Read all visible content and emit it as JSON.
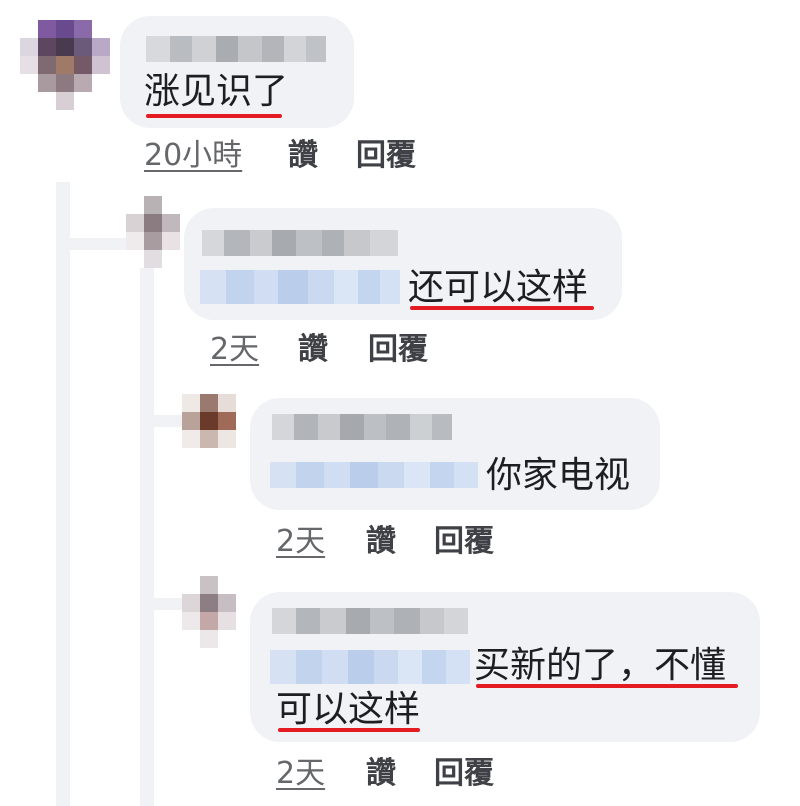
{
  "comments": [
    {
      "text_lines": [
        "涨见识了"
      ],
      "time": "20小時",
      "like": "讚",
      "reply": "回覆"
    },
    {
      "text_lines": [
        "还可以这样"
      ],
      "time": "2天",
      "like": "讚",
      "reply": "回覆"
    },
    {
      "text_lines": [
        "你家电视"
      ],
      "time": "2天",
      "like": "讚",
      "reply": "回覆"
    },
    {
      "text_lines": [
        "买新的了，不懂",
        "可以这样"
      ],
      "time": "2天",
      "like": "讚",
      "reply": "回覆"
    }
  ],
  "colors": {
    "bubble": "#f0f2f5",
    "highlight_underline": "#e41b23",
    "mention_blur": "#c5d6f0"
  }
}
